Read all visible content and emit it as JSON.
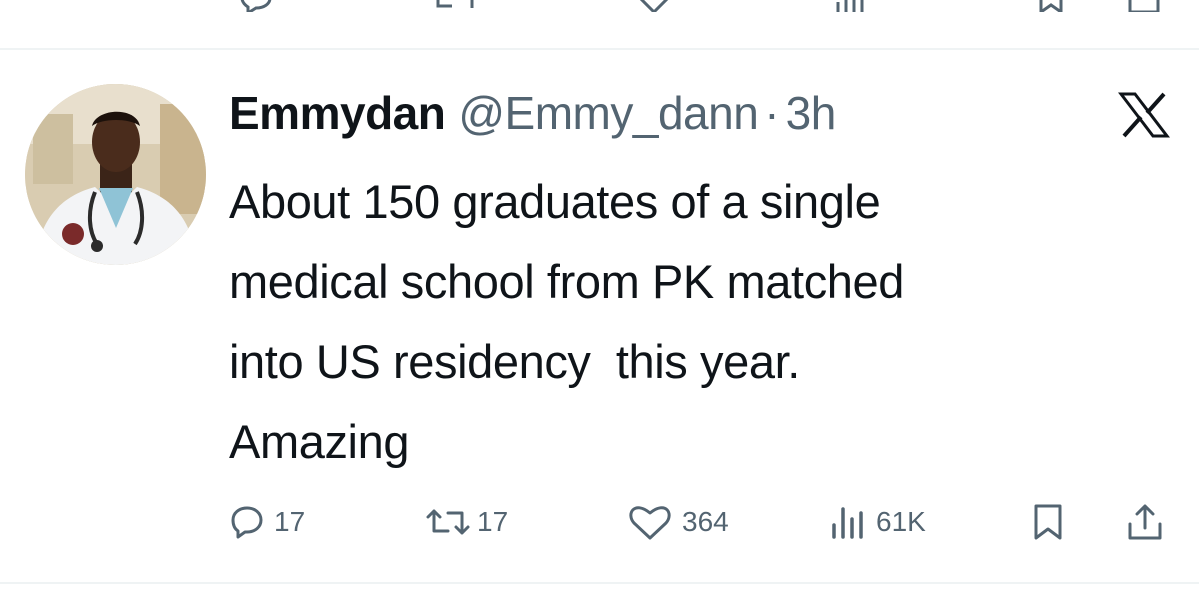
{
  "tweet": {
    "author": {
      "display_name": "Emmydan",
      "handle": "@Emmy_dann",
      "separator": "·",
      "timestamp": "3h"
    },
    "text": "About 150 graduates of a single\nmedical school from PK matched\ninto US residency  this year.\nAmazing",
    "actions": {
      "replies": "17",
      "reposts": "17",
      "likes": "364",
      "views": "61K"
    }
  },
  "icons": {
    "platform_logo": "x-logo-icon",
    "reply": "reply-icon",
    "repost": "repost-icon",
    "like": "heart-icon",
    "views": "views-icon",
    "bookmark": "bookmark-icon",
    "share": "share-icon"
  },
  "colors": {
    "text_primary": "#0f1419",
    "text_secondary": "#536471",
    "divider": "#eff3f4"
  }
}
